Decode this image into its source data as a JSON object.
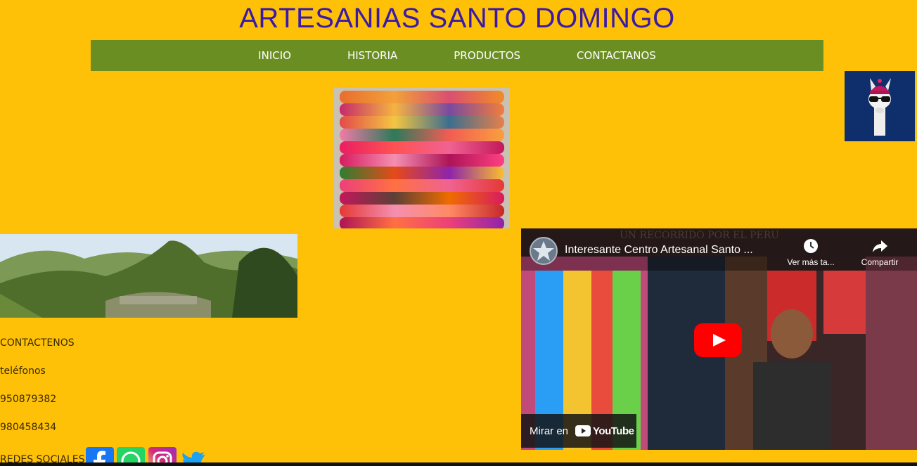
{
  "site": {
    "title": "ARTESANIAS SANTO DOMINGO"
  },
  "nav": {
    "items": [
      {
        "label": "INICIO"
      },
      {
        "label": "HISTORIA"
      },
      {
        "label": "PRODUCTOS"
      },
      {
        "label": "CONTACTANOS"
      }
    ]
  },
  "contact": {
    "heading": "CONTACTENOS",
    "phones_label": "teléfonos",
    "phone1": "950879382",
    "phone2": "980458434",
    "social_label": "REDES SOCIALES"
  },
  "video": {
    "title": "Interesante Centro Artesanal Santo ...",
    "channel_overlay": "UN RECORRIDO POR EL PERU",
    "watch_later": "Ver más ta...",
    "share": "Compartir",
    "watch_on": "Mirar en",
    "youtube": "YouTube"
  },
  "colors": {
    "background": "#ffc107",
    "nav": "#6b8e23",
    "title": "#3b1aa8"
  }
}
